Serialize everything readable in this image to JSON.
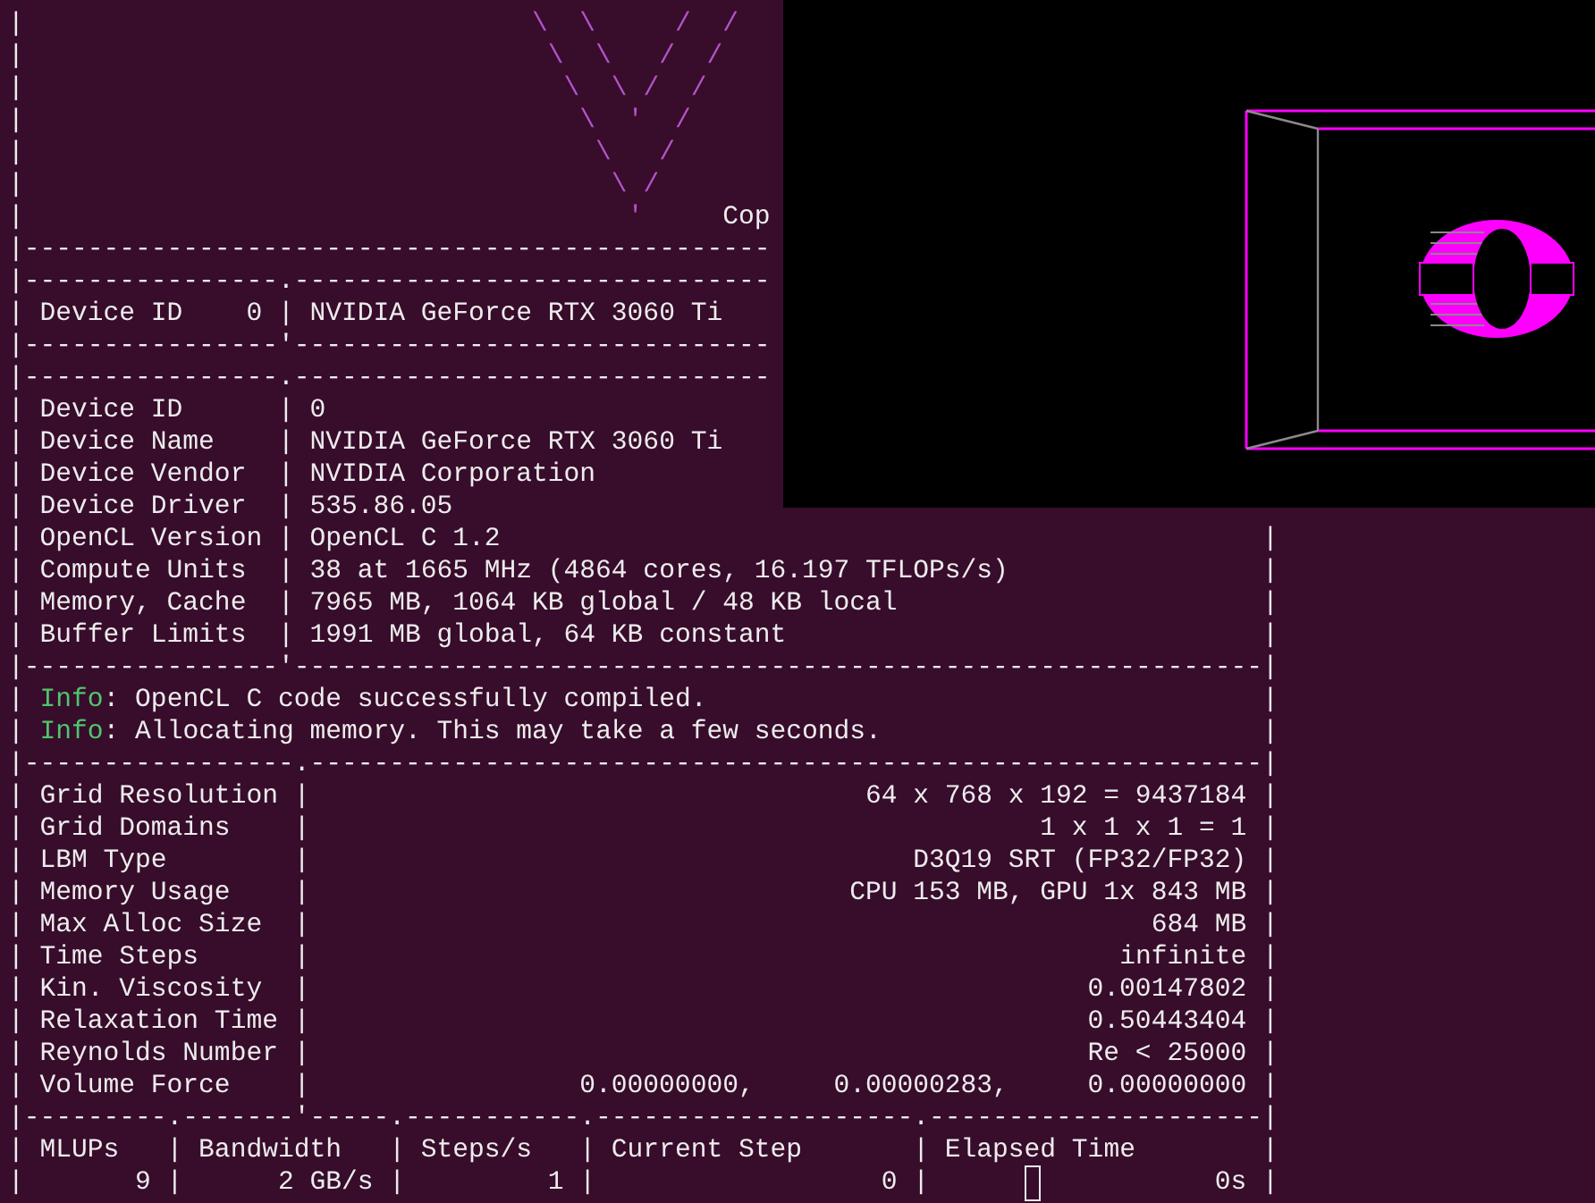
{
  "terminal": {
    "lines": [
      {
        "parts": [
          {
            "kind": "text",
            "text": "|"
          },
          {
            "kind": "art",
            "text": "                                \\  \\     /  /"
          }
        ]
      },
      {
        "parts": [
          {
            "kind": "text",
            "text": "|"
          },
          {
            "kind": "art",
            "text": "                                 \\  \\   /  /"
          }
        ]
      },
      {
        "parts": [
          {
            "kind": "text",
            "text": "|"
          },
          {
            "kind": "art",
            "text": "                                  \\  \\ /  /"
          }
        ]
      },
      {
        "parts": [
          {
            "kind": "text",
            "text": "|"
          },
          {
            "kind": "art",
            "text": "                                   \\  '  /"
          }
        ]
      },
      {
        "parts": [
          {
            "kind": "text",
            "text": "|"
          },
          {
            "kind": "art",
            "text": "                                    \\   /"
          }
        ]
      },
      {
        "parts": [
          {
            "kind": "text",
            "text": "|"
          },
          {
            "kind": "art",
            "text": "                                     \\ /"
          }
        ]
      },
      {
        "parts": [
          {
            "kind": "text",
            "text": "|"
          },
          {
            "kind": "art",
            "text": "                                      '"
          },
          {
            "kind": "text",
            "text": "     Cop"
          }
        ]
      },
      {
        "parts": [
          {
            "kind": "text",
            "text": "|-----------------------------------------------"
          }
        ]
      },
      {
        "parts": [
          {
            "kind": "text",
            "text": "|----------------.------------------------------"
          }
        ]
      },
      {
        "parts": [
          {
            "kind": "text",
            "text": "| Device ID    0 | NVIDIA GeForce RTX 3060 Ti"
          }
        ]
      },
      {
        "parts": [
          {
            "kind": "text",
            "text": "|----------------'------------------------------"
          }
        ]
      },
      {
        "parts": [
          {
            "kind": "text",
            "text": "|----------------.------------------------------"
          }
        ]
      },
      {
        "parts": [
          {
            "kind": "text",
            "text": "| Device ID      | 0"
          }
        ]
      },
      {
        "parts": [
          {
            "kind": "text",
            "text": "| Device Name    | NVIDIA GeForce RTX 3060 Ti"
          }
        ]
      },
      {
        "parts": [
          {
            "kind": "text",
            "text": "| Device Vendor  | NVIDIA Corporation"
          }
        ]
      },
      {
        "parts": [
          {
            "kind": "text",
            "text": "| Device Driver  | 535.86.05"
          }
        ]
      },
      {
        "parts": [
          {
            "kind": "text",
            "text": "| OpenCL Version | OpenCL C 1.2"
          }
        ],
        "end": "|"
      },
      {
        "parts": [
          {
            "kind": "text",
            "text": "| Compute Units  | 38 at 1665 MHz (4864 cores, 16.197 TFLOPs/s)"
          }
        ],
        "end": "|"
      },
      {
        "parts": [
          {
            "kind": "text",
            "text": "| Memory, Cache  | 7965 MB, 1064 KB global / 48 KB local"
          }
        ],
        "end": "|"
      },
      {
        "parts": [
          {
            "kind": "text",
            "text": "| Buffer Limits  | 1991 MB global, 64 KB constant"
          }
        ],
        "end": "|"
      },
      {
        "parts": [
          {
            "kind": "text",
            "text": "|----------------'-------------------------------------------------------------"
          }
        ],
        "end": "|"
      },
      {
        "parts": [
          {
            "kind": "text",
            "text": "| "
          },
          {
            "kind": "info",
            "text": "Info"
          },
          {
            "kind": "text",
            "text": ": OpenCL C code successfully compiled."
          }
        ],
        "end": "|"
      },
      {
        "parts": [
          {
            "kind": "text",
            "text": "| "
          },
          {
            "kind": "info",
            "text": "Info"
          },
          {
            "kind": "text",
            "text": ": Allocating memory. This may take a few seconds."
          }
        ],
        "end": "|"
      },
      {
        "parts": [
          {
            "kind": "text",
            "text": "|-----------------.------------------------------------------------------------"
          }
        ],
        "end": "|"
      },
      {
        "parts": [
          {
            "kind": "text",
            "text": "| Grid Resolution |"
          }
        ],
        "end": "64 x 768 x 192 = 9437184 |"
      },
      {
        "parts": [
          {
            "kind": "text",
            "text": "| Grid Domains    |"
          }
        ],
        "end": "1 x 1 x 1 = 1 |"
      },
      {
        "parts": [
          {
            "kind": "text",
            "text": "| LBM Type        |"
          }
        ],
        "end": "D3Q19 SRT (FP32/FP32) |"
      },
      {
        "parts": [
          {
            "kind": "text",
            "text": "| Memory Usage    |"
          }
        ],
        "end": "CPU 153 MB, GPU 1x 843 MB |"
      },
      {
        "parts": [
          {
            "kind": "text",
            "text": "| Max Alloc Size  |"
          }
        ],
        "end": "684 MB |"
      },
      {
        "parts": [
          {
            "kind": "text",
            "text": "| Time Steps      |"
          }
        ],
        "end": "infinite |"
      },
      {
        "parts": [
          {
            "kind": "text",
            "text": "| Kin. Viscosity  |"
          }
        ],
        "end": "0.00147802 |"
      },
      {
        "parts": [
          {
            "kind": "text",
            "text": "| Relaxation Time |"
          }
        ],
        "end": "0.50443404 |"
      },
      {
        "parts": [
          {
            "kind": "text",
            "text": "| Reynolds Number |"
          }
        ],
        "end": "Re < 25000 |"
      },
      {
        "parts": [
          {
            "kind": "text",
            "text": "| Volume Force    |"
          }
        ],
        "end": "0.00000000,     0.00000283,     0.00000000 |"
      },
      {
        "parts": [
          {
            "kind": "text",
            "text": "|---------.-------'-----.-----------.--------------------.---------------------"
          }
        ],
        "end": "|"
      },
      {
        "parts": [
          {
            "kind": "text",
            "text": "| MLUPs   | Bandwidth   | Steps/s   | Current Step       | Elapsed Time"
          }
        ],
        "end": "|"
      },
      {
        "parts": [
          {
            "kind": "text",
            "text": "|       9 |      2 GB/s |         1 |                  0 |      "
          },
          {
            "kind": "cursor"
          }
        ],
        "end": "           0s |"
      }
    ]
  }
}
